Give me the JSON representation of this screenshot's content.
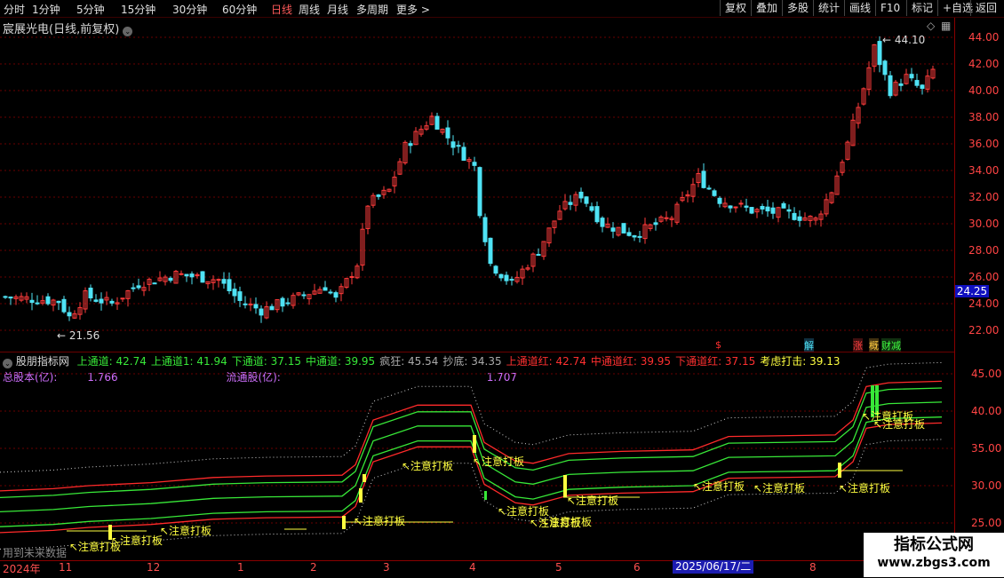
{
  "toolbar": {
    "periods": [
      "分时",
      "1分钟",
      "5分钟",
      "15分钟",
      "30分钟",
      "60分钟",
      "日线",
      "周线",
      "月线",
      "多周期",
      "更多 >"
    ],
    "active_period": "日线",
    "buttons": [
      "复权",
      "叠加",
      "多股",
      "统计",
      "画线",
      "F10",
      "标记",
      "+自选",
      "返回"
    ]
  },
  "stock_title": "宸展光电(日线,前复权)",
  "price_axis": [
    "44.00",
    "42.00",
    "40.00",
    "38.00",
    "36.00",
    "34.00",
    "32.00",
    "30.00",
    "28.00",
    "26.00",
    "24.00",
    "22.00"
  ],
  "current_price": "24.25",
  "high_label": "44.10",
  "low_label": "21.56",
  "markers": {
    "m1": "$",
    "m2": "解",
    "m3": "涨",
    "m4": "概",
    "m5": "财减"
  },
  "indicator": {
    "name": "股朋指标网",
    "values": [
      {
        "t": "上通道: 42.74",
        "c": "#38e838"
      },
      {
        "t": "上通道1: 41.94",
        "c": "#38e838"
      },
      {
        "t": "下通道: 37.15",
        "c": "#38e838"
      },
      {
        "t": "中通道: 39.95",
        "c": "#38e838"
      },
      {
        "t": "疯狂: 45.54",
        "c": "#aaaaaa"
      },
      {
        "t": "抄底: 34.35",
        "c": "#aaaaaa"
      },
      {
        "t": "上通道红: 42.74",
        "c": "#ff3030"
      },
      {
        "t": "中通道红: 39.95",
        "c": "#ff3030"
      },
      {
        "t": "下通道红: 37.15",
        "c": "#ff3030"
      },
      {
        "t": "考虑打击: 39.13",
        "c": "#ffff40"
      }
    ],
    "total_shares_label": "总股本(亿):",
    "total_shares": "1.766",
    "float_shares_label": "流通股(亿):",
    "float_shares": "1.707"
  },
  "indicator_axis": [
    "45.00",
    "40.00",
    "35.00",
    "30.00",
    "25.00"
  ],
  "signal_text": "注意打板",
  "future_text": "用到未来数据",
  "dates": {
    "year": "2024年",
    "months": [
      "11",
      "12",
      "1",
      "2",
      "3",
      "4",
      "5",
      "6",
      "8"
    ],
    "highlighted_date": "2025/06/17/二"
  },
  "watermark": {
    "title": "指标公式网",
    "url": "www.zbgs3.com"
  },
  "colors": {
    "up": "#ff3b3b",
    "down": "#4fe3f5",
    "green": "#38e838",
    "yellow": "#ffff40"
  }
}
